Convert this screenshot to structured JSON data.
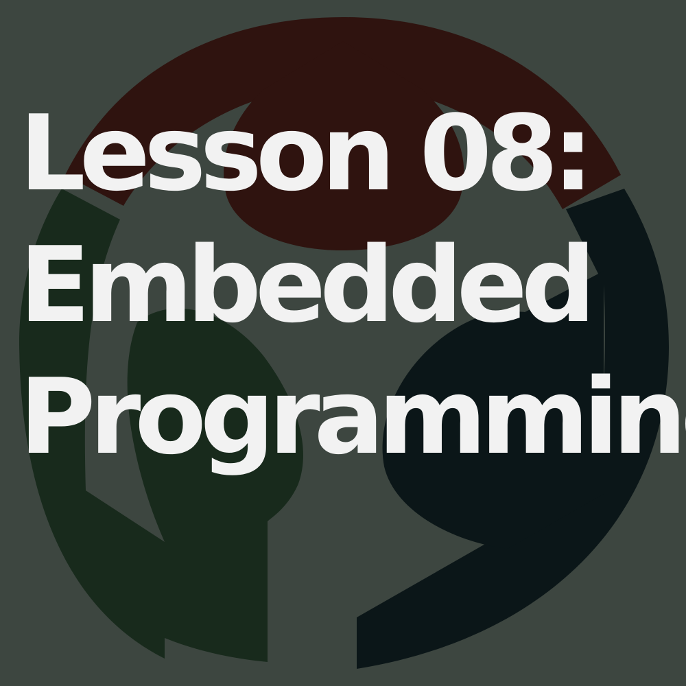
{
  "lesson": {
    "title_lines": [
      "Lesson 08:",
      "Embedded",
      "Programming"
    ]
  },
  "logo": {
    "icon": "fab-lab-logo-icon",
    "colors": {
      "background": "#3d4640",
      "top_segment": "#2f130f",
      "left_segment": "#182a1c",
      "right_segment": "#0b1618"
    }
  },
  "text_color": "#f2f2f2"
}
